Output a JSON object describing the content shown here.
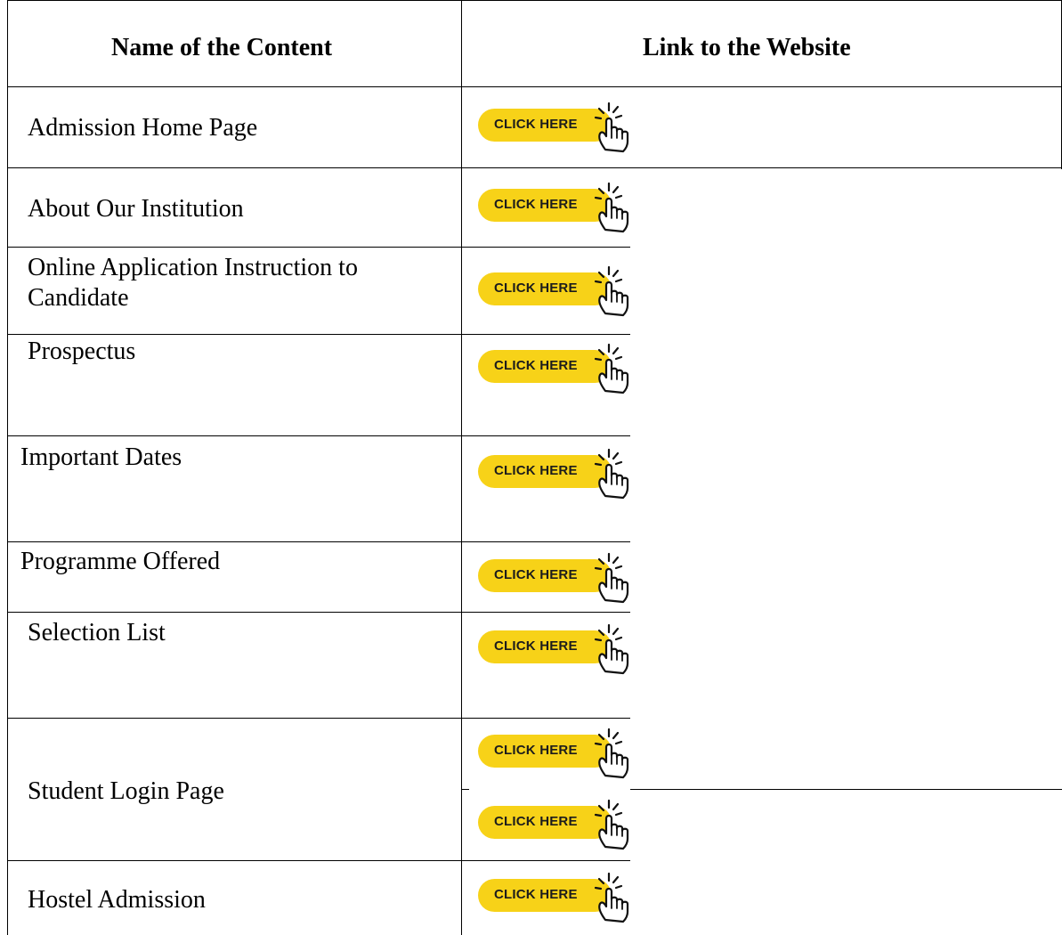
{
  "table": {
    "headers": {
      "content": "Name of the Content",
      "link": "Link to the Website"
    },
    "rows": [
      {
        "name": "Admission Home Page"
      },
      {
        "name": "About Our Institution"
      },
      {
        "name_lines": [
          "Online Application Instruction to",
          "Candidate"
        ]
      },
      {
        "name": "Prospectus"
      },
      {
        "name": "Important Dates"
      },
      {
        "name": "Programme Offered"
      },
      {
        "name": "Selection List"
      },
      {
        "name": "Student Login Page"
      },
      {
        "name": "Hostel Admission"
      }
    ],
    "button_label": "CLICK HERE"
  },
  "colors": {
    "button_fill": "#f7d218",
    "button_text": "#1c1c1c",
    "border": "#000000"
  },
  "icons": {
    "button_icon": "pointing-hand-click-icon"
  }
}
